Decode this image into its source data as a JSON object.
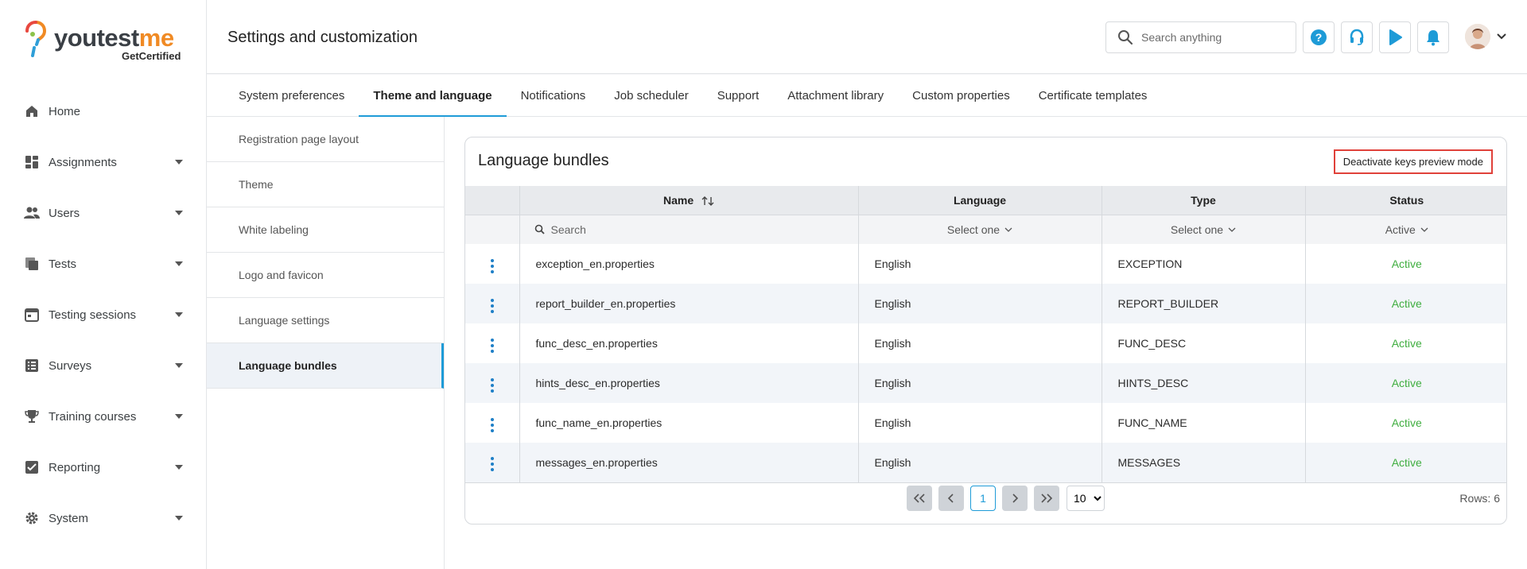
{
  "brand": {
    "name_part1": "youtest",
    "name_part2": "me",
    "tagline": "GetCertified"
  },
  "sidebar": {
    "items": [
      {
        "label": "Home",
        "icon": "home-icon",
        "expandable": false
      },
      {
        "label": "Assignments",
        "icon": "assignments-icon",
        "expandable": true
      },
      {
        "label": "Users",
        "icon": "users-icon",
        "expandable": true
      },
      {
        "label": "Tests",
        "icon": "tests-icon",
        "expandable": true
      },
      {
        "label": "Testing sessions",
        "icon": "calendar-icon",
        "expandable": true
      },
      {
        "label": "Surveys",
        "icon": "surveys-icon",
        "expandable": true
      },
      {
        "label": "Training courses",
        "icon": "trophy-icon",
        "expandable": true
      },
      {
        "label": "Reporting",
        "icon": "reporting-icon",
        "expandable": true
      },
      {
        "label": "System",
        "icon": "gear-icon",
        "expandable": true
      }
    ]
  },
  "header": {
    "title": "Settings and customization",
    "search_placeholder": "Search anything",
    "buttons": [
      "help-icon",
      "headset-icon",
      "play-icon",
      "bell-icon"
    ]
  },
  "tabs": [
    {
      "label": "System preferences",
      "active": false
    },
    {
      "label": "Theme and language",
      "active": true
    },
    {
      "label": "Notifications",
      "active": false
    },
    {
      "label": "Job scheduler",
      "active": false
    },
    {
      "label": "Support",
      "active": false
    },
    {
      "label": "Attachment library",
      "active": false
    },
    {
      "label": "Custom properties",
      "active": false
    },
    {
      "label": "Certificate templates",
      "active": false
    }
  ],
  "subnav": {
    "items": [
      {
        "label": "Registration page layout",
        "active": false
      },
      {
        "label": "Theme",
        "active": false
      },
      {
        "label": "White labeling",
        "active": false
      },
      {
        "label": "Logo and favicon",
        "active": false
      },
      {
        "label": "Language settings",
        "active": false
      },
      {
        "label": "Language bundles",
        "active": true
      }
    ]
  },
  "card": {
    "title": "Language bundles",
    "deactivate_label": "Deactivate keys preview mode",
    "columns": {
      "name": "Name",
      "language": "Language",
      "type": "Type",
      "status": "Status"
    },
    "filters": {
      "search_placeholder": "Search",
      "language": "Select one",
      "type": "Select one",
      "status": "Active"
    },
    "rows": [
      {
        "name": "exception_en.properties",
        "language": "English",
        "type": "EXCEPTION",
        "status": "Active"
      },
      {
        "name": "report_builder_en.properties",
        "language": "English",
        "type": "REPORT_BUILDER",
        "status": "Active"
      },
      {
        "name": "func_desc_en.properties",
        "language": "English",
        "type": "FUNC_DESC",
        "status": "Active"
      },
      {
        "name": "hints_desc_en.properties",
        "language": "English",
        "type": "HINTS_DESC",
        "status": "Active"
      },
      {
        "name": "func_name_en.properties",
        "language": "English",
        "type": "FUNC_NAME",
        "status": "Active"
      },
      {
        "name": "messages_en.properties",
        "language": "English",
        "type": "MESSAGES",
        "status": "Active"
      }
    ],
    "pagination": {
      "current_page": "1",
      "rows_per_page": "10",
      "rows_text": "Rows: 6"
    }
  },
  "colors": {
    "accent": "#1e9bd7",
    "active_status": "#3fae3f",
    "highlight_border": "#e0413a"
  }
}
